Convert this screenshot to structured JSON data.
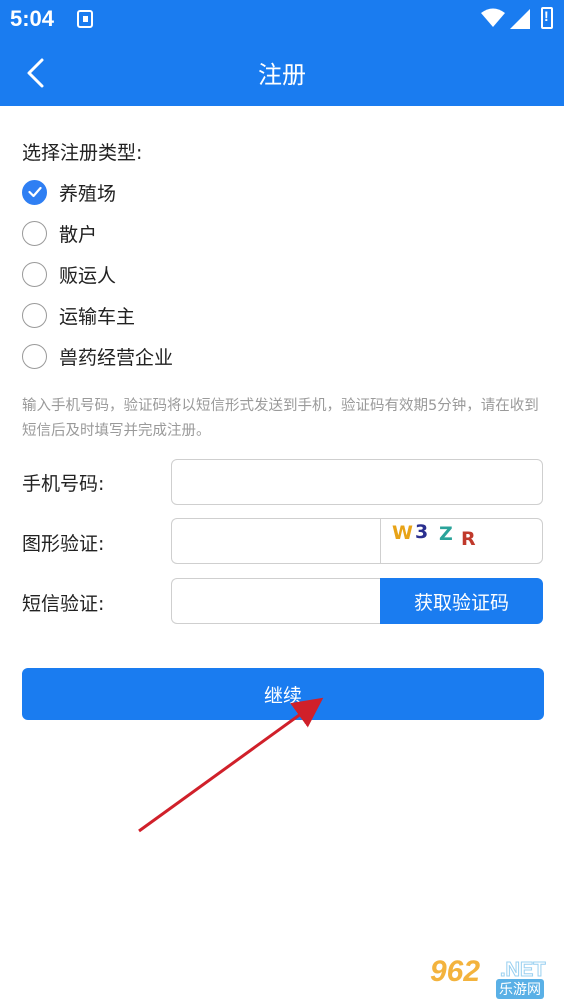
{
  "status_bar": {
    "time": "5:04"
  },
  "header": {
    "title": "注册"
  },
  "register_type": {
    "label": "选择注册类型:",
    "options": [
      {
        "label": "养殖场",
        "checked": true
      },
      {
        "label": "散户",
        "checked": false
      },
      {
        "label": "贩运人",
        "checked": false
      },
      {
        "label": "运输车主",
        "checked": false
      },
      {
        "label": "兽药经营企业",
        "checked": false
      }
    ]
  },
  "hint": "输入手机号码，验证码将以短信形式发送到手机，验证码有效期5分钟，请在收到短信后及时填写并完成注册。",
  "form": {
    "phone_label": "手机号码:",
    "phone_value": "",
    "captcha_label": "图形验证:",
    "captcha_value": "",
    "captcha_chars": [
      {
        "char": "W",
        "color": "#e8a317"
      },
      {
        "char": "3",
        "color": "#2a2f8f"
      },
      {
        "char": "Z",
        "color": "#2aa39a"
      },
      {
        "char": "R",
        "color": "#c0392b"
      }
    ],
    "sms_label": "短信验证:",
    "sms_value": "",
    "get_code_label": "获取验证码"
  },
  "continue_label": "继续",
  "watermark": {
    "brand": "962",
    "tld": ".NET",
    "cn": "乐游网"
  },
  "colors": {
    "primary": "#1a7cf0",
    "annotation_arrow": "#d0202a"
  }
}
